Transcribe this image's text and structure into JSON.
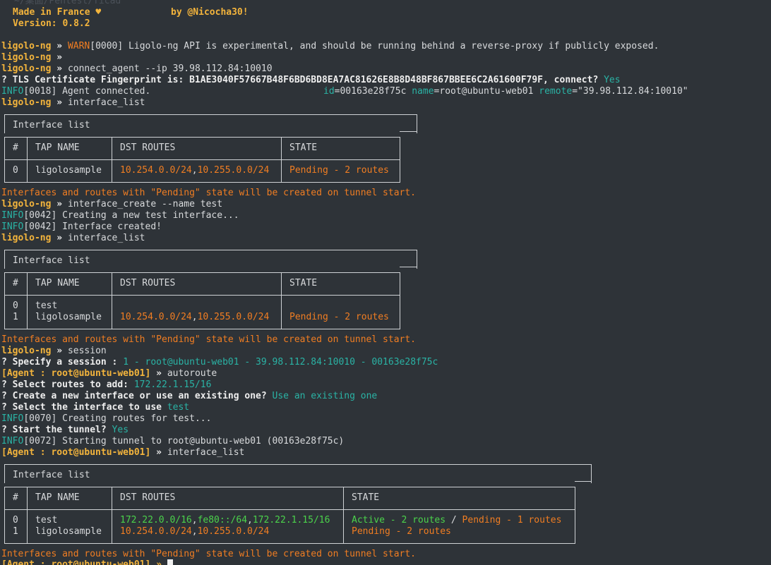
{
  "colors": {
    "background": "#2e3338",
    "text": "#d8dadc",
    "prompt": "#f3b43c",
    "warn": "#f07d22",
    "info": "#2ab3a5",
    "success": "#4bd34b",
    "pending": "#f07d22"
  },
  "header": {
    "path_ghost": "~/桌面/Pentest/ficad",
    "made_in": "Made in France ♥",
    "by": "by @Nicocha30!",
    "version": "Version: 0.8.2"
  },
  "prompt": {
    "label": "ligolo-ng",
    "arrow": "»"
  },
  "agent_prompt": {
    "label": "[Agent : root@ubuntu-web01]",
    "arrow": "»"
  },
  "lines": {
    "warn_tag": "WARN",
    "warn_msg": "[0000] Ligolo-ng API is experimental, and should be running behind a reverse-proxy if publicly exposed.",
    "cmd_connect": "connect_agent --ip 39.98.112.84:10010",
    "tls_q": "? TLS Certificate Fingerprint is: B1AE3040F57667B48F6BD6BD8EA7AC81626E8B8D48BF867BBEE6C2A61600F79F, connect?",
    "tls_a": "Yes",
    "info_tag": "INFO",
    "agent_connected": "[0018] Agent connected.",
    "kv_id_k": "id",
    "kv_id_v": "=00163e28f75c",
    "kv_name_k": "name",
    "kv_name_v": "=root@ubuntu-web01",
    "kv_remote_k": "remote",
    "kv_remote_v": "=\"39.98.112.84:10010\"",
    "cmd_list": "interface_list",
    "pending_note": "Interfaces and routes with \"Pending\" state will be created on tunnel start.",
    "cmd_create": "interface_create --name test",
    "creating_iface": "[0042] Creating a new test interface...",
    "iface_created": "[0042] Interface created!",
    "cmd_session": "session",
    "specify_q": "? Specify a session :",
    "specify_a": "1 - root@ubuntu-web01 - 39.98.112.84:10010 - 00163e28f75c",
    "cmd_autoroute": "autoroute",
    "select_routes_q": "? Select routes to add:",
    "select_routes_a": "172.22.1.15/16",
    "create_new_q": "? Create a new interface or use an existing one?",
    "create_new_a": "Use an existing one",
    "select_iface_q": "? Select the interface to use",
    "select_iface_a": "test",
    "start_tunnel_q": "? Start the tunnel?",
    "start_tunnel_a": "Yes",
    "creating_routes": "[0070] Creating routes for test...",
    "starting_tunnel": "[0072] Starting tunnel to root@ubuntu-web01 (00163e28f75c)",
    "last_prompt": "[Agent : root@ubuntu-web01] »"
  },
  "table": {
    "title": "Interface list",
    "headers": [
      "#",
      "TAP NAME",
      "DST ROUTES",
      "STATE"
    ],
    "t1": {
      "rows": [
        {
          "idx": "0",
          "tap": "ligolosample",
          "route_a": "10.254.0.0/24",
          "route_b": "10.255.0.0/24",
          "state": "Pending - 2 routes"
        }
      ]
    },
    "t2": {
      "rows": [
        {
          "idx": "0",
          "tap": "test",
          "route_a": "",
          "route_b": "",
          "state": ""
        },
        {
          "idx": "1",
          "tap": "ligolosample",
          "route_a": "10.254.0.0/24",
          "route_b": "10.255.0.0/24",
          "state": "Pending - 2 routes"
        }
      ]
    },
    "t3": {
      "rows": [
        {
          "idx": "0",
          "tap": "test",
          "route_a": "172.22.0.0/16",
          "route_b": "fe80::/64",
          "route_c": "172.22.1.15/16",
          "state_active": "Active - 2 routes",
          "state_sep": " / ",
          "state_pending": "Pending - 1 routes"
        },
        {
          "idx": "1",
          "tap": "ligolosample",
          "route_a": "10.254.0.0/24",
          "route_b": "10.255.0.0/24",
          "state": "Pending - 2 routes"
        }
      ]
    }
  }
}
